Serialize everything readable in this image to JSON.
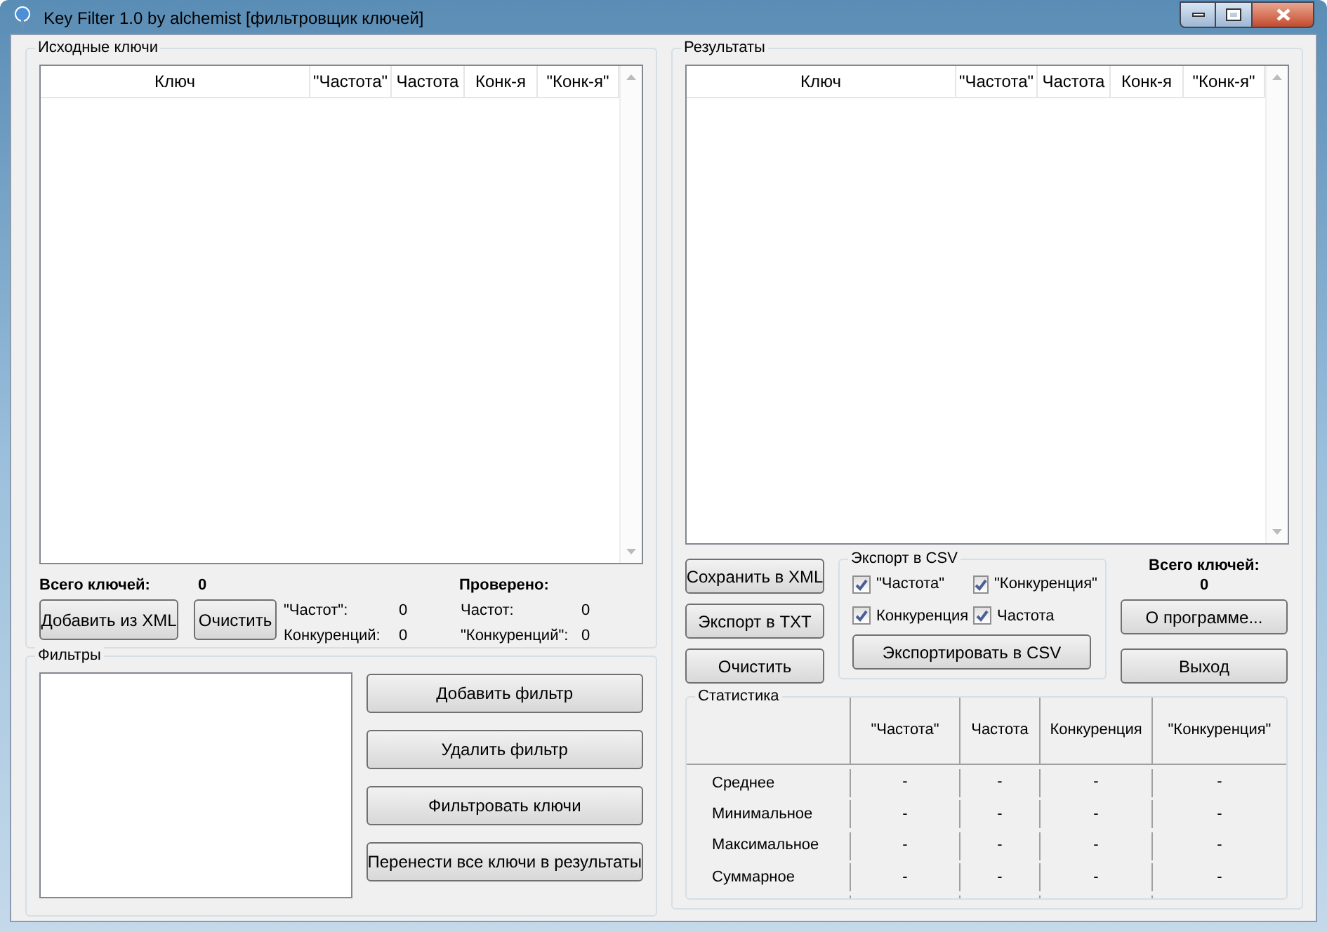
{
  "window": {
    "title": "Key Filter 1.0 by alchemist [фильтровщик ключей]"
  },
  "source": {
    "title": "Исходные ключи",
    "columns": [
      "Ключ",
      "\"Частота\"",
      "Частота",
      "Конк-я",
      "\"Конк-я\""
    ],
    "total_label": "Всего ключей:",
    "total_value": "0",
    "buttons": [
      "Добавить из XML",
      "Очистить"
    ],
    "stats_left": [
      {
        "label": "\"Частот\":",
        "value": "0"
      },
      {
        "label": "Конкуренций:",
        "value": "0"
      }
    ],
    "checked_title": "Проверено:",
    "stats_right": [
      {
        "label": "Частот:",
        "value": "0"
      },
      {
        "label": "\"Конкуренций\":",
        "value": "0"
      }
    ]
  },
  "filters": {
    "title": "Фильтры",
    "buttons": [
      "Добавить фильтр",
      "Удалить фильтр",
      "Фильтровать ключи",
      "Перенести все ключи в результаты"
    ]
  },
  "results": {
    "title": "Результаты",
    "columns": [
      "Ключ",
      "\"Частота\"",
      "Частота",
      "Конк-я",
      "\"Конк-я\""
    ],
    "buttons": [
      "Сохранить в XML",
      "Экспорт в TXT",
      "Очистить"
    ],
    "export": {
      "title": "Экспорт в CSV",
      "options": [
        {
          "label": "\"Частота\"",
          "checked": true
        },
        {
          "label": "\"Конкуренция\"",
          "checked": true
        },
        {
          "label": "Конкуренция",
          "checked": true
        },
        {
          "label": "Частота",
          "checked": true
        }
      ],
      "button": "Экспортировать в CSV"
    },
    "total_label": "Всего ключей:",
    "total_value": "0",
    "side_buttons": [
      "О программе...",
      "Выход"
    ]
  },
  "statistics": {
    "title": "Статистика",
    "columns": [
      "\"Частота\"",
      "Частота",
      "Конкуренция",
      "\"Конкуренция\""
    ],
    "rows": [
      {
        "label": "Среднее",
        "values": [
          "-",
          "-",
          "-",
          "-"
        ]
      },
      {
        "label": "Минимальное",
        "values": [
          "-",
          "-",
          "-",
          "-"
        ]
      },
      {
        "label": "Максимальное",
        "values": [
          "-",
          "-",
          "-",
          "-"
        ]
      },
      {
        "label": "Суммарное",
        "values": [
          "-",
          "-",
          "-",
          "-"
        ]
      }
    ]
  }
}
